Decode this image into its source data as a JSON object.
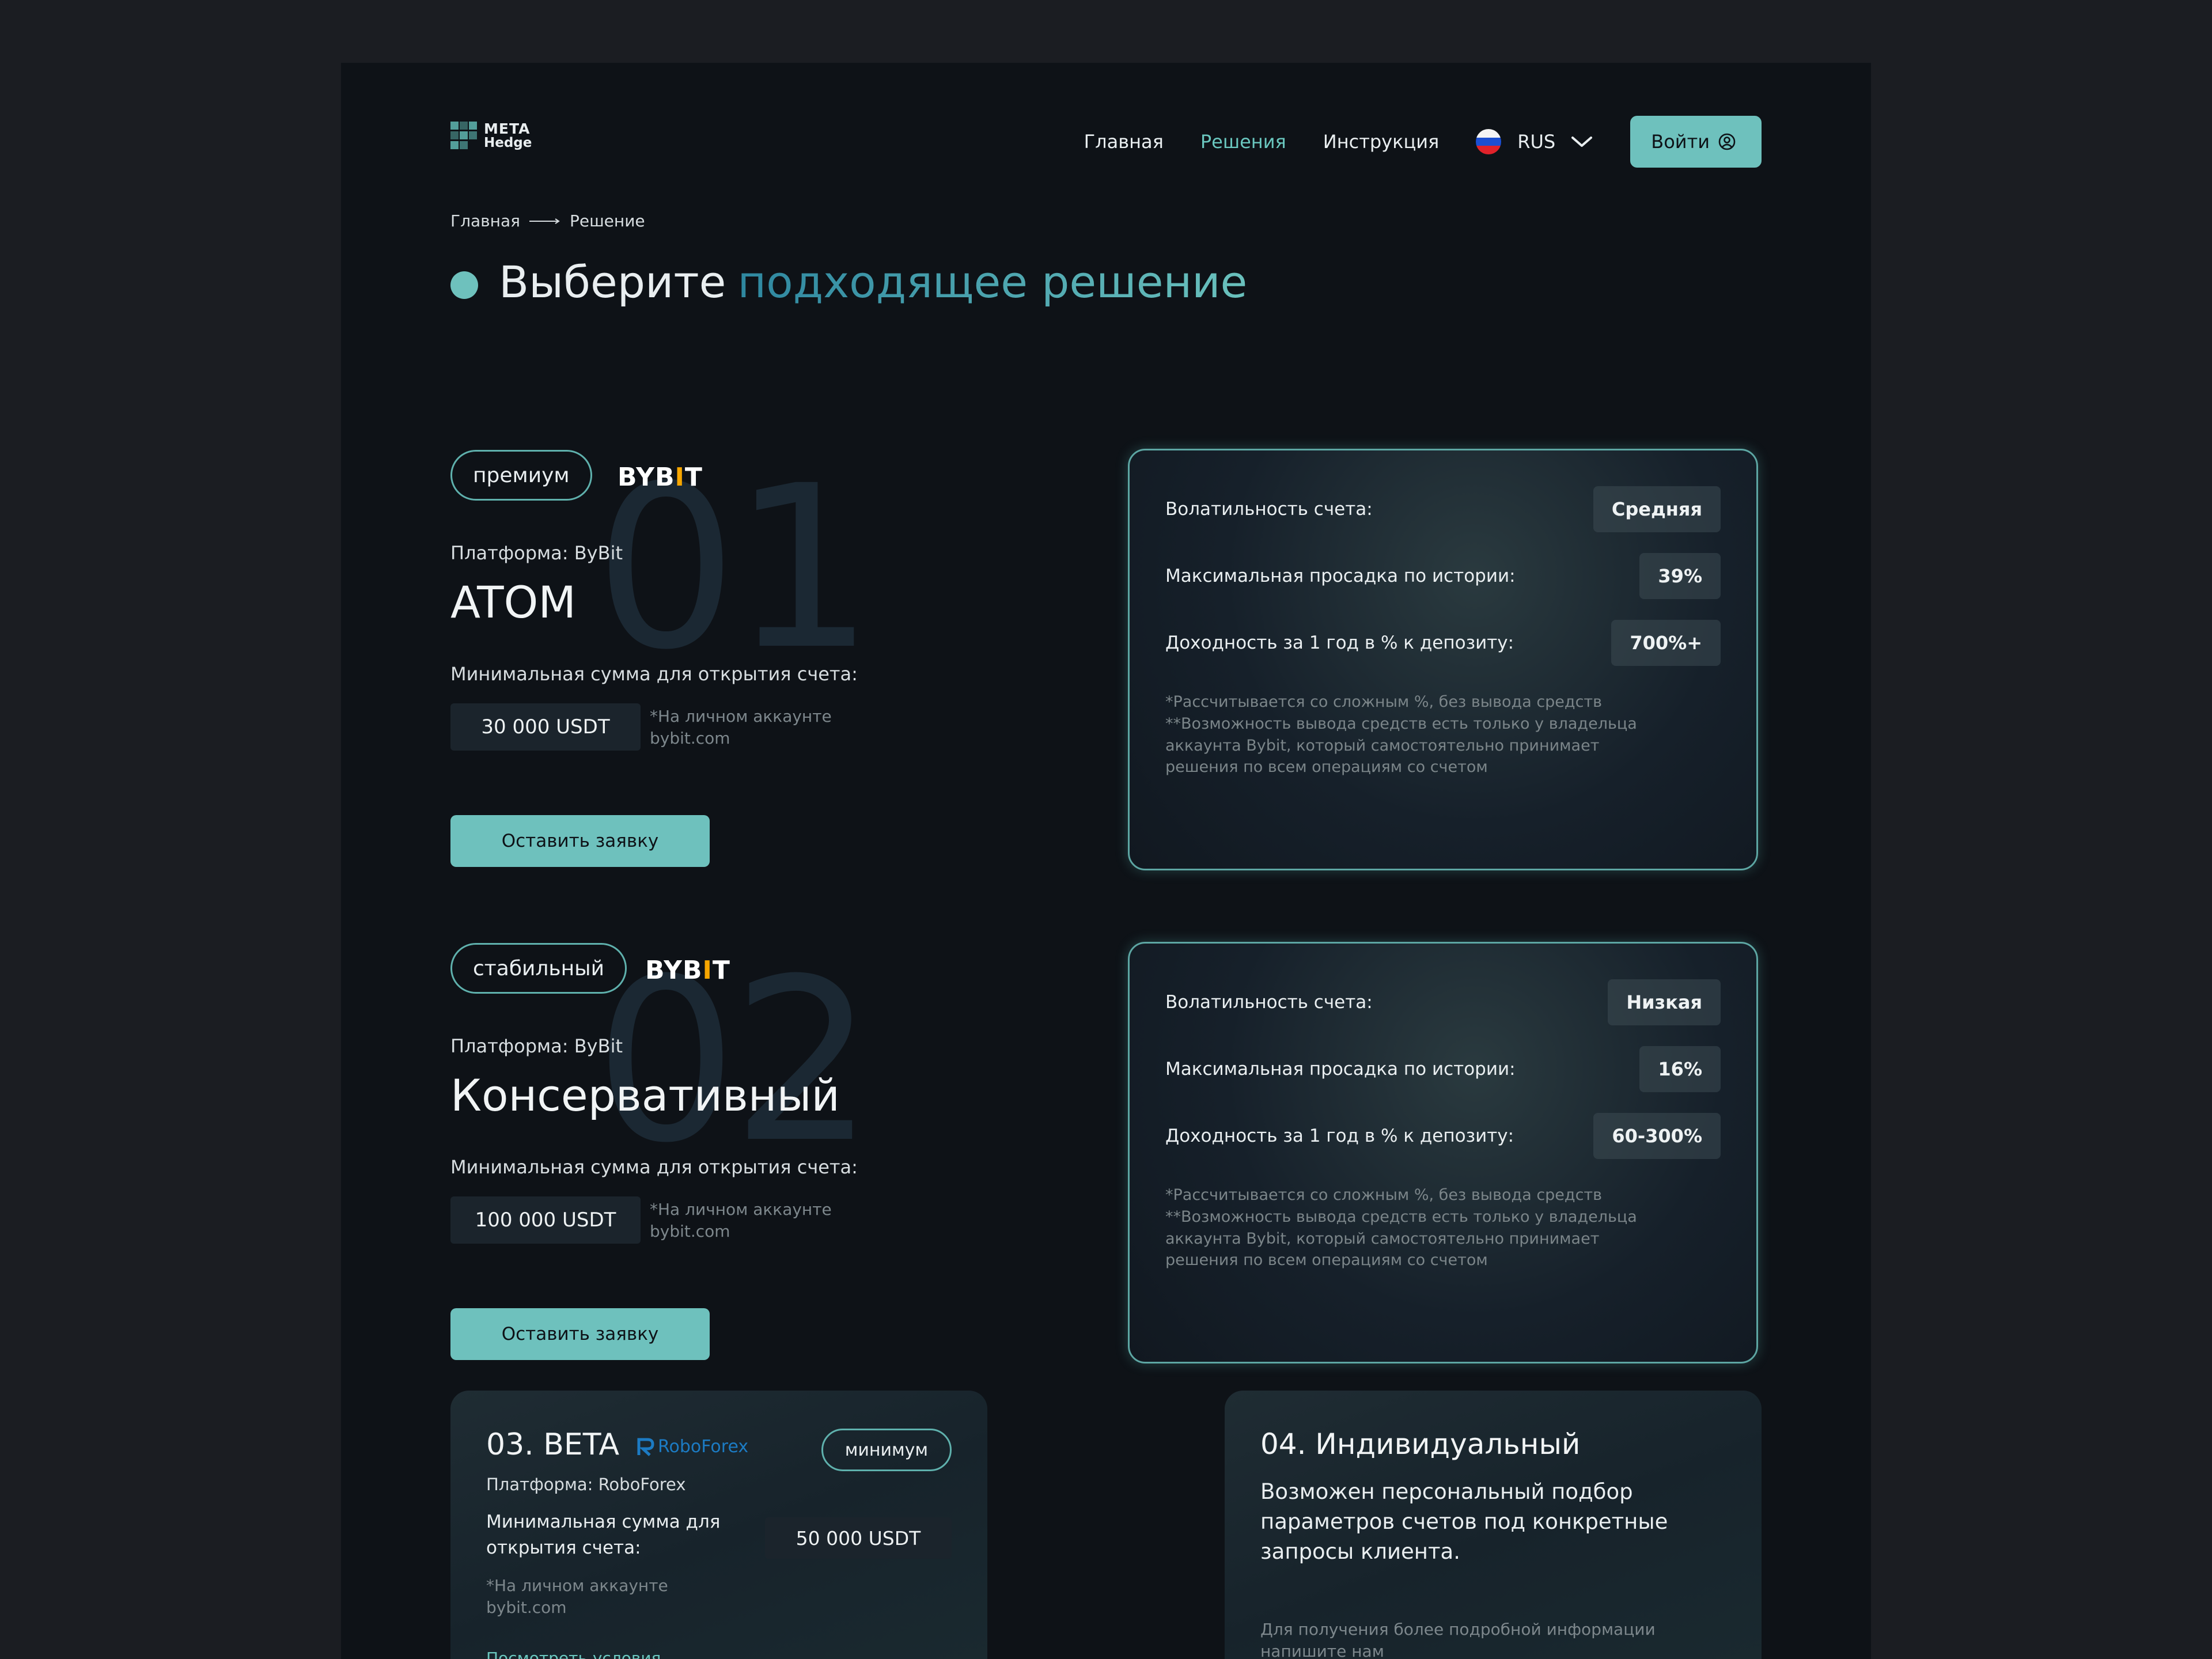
{
  "header": {
    "logo_line1": "META",
    "logo_line2": "Hedge",
    "nav": [
      "Главная",
      "Решения",
      "Инструкция"
    ],
    "active_nav": "Решения",
    "language": "RUS",
    "login_label": "Войти"
  },
  "breadcrumb": {
    "home": "Главная",
    "current": "Решение"
  },
  "title": {
    "lead": "Выберите",
    "accent": "подходящее решение"
  },
  "products": [
    {
      "number": "01",
      "tag": "премиум",
      "exchange": {
        "a": "BYB",
        "i": "I",
        "b": "T"
      },
      "platform": "Платформа: ByBit",
      "name": "ATOM",
      "min_label": "Минимальная сумма для открытия счета:",
      "amount": "30 000 USDT",
      "amount_note_1": "*На личном аккаунте",
      "amount_note_2": "bybit.com",
      "apply_label": "Оставить заявку",
      "stats": [
        {
          "label": "Волатильность счета:",
          "value": "Средняя"
        },
        {
          "label": "Максимальная просадка по истории:",
          "value": "39%"
        },
        {
          "label": "Доходность за 1 год в % к депозиту:",
          "value": "700%+"
        }
      ],
      "notes": [
        "*Рассчитывается со сложным %, без вывода средств",
        "**Возможность вывода средств есть только у владельца аккаунта Bybit, который самостоятельно принимает решения по всем операциям со счетом"
      ]
    },
    {
      "number": "02",
      "tag": "стабильный",
      "exchange": {
        "a": "BYB",
        "i": "I",
        "b": "T"
      },
      "platform": "Платформа: ByBit",
      "name": "Консервативный",
      "min_label": "Минимальная сумма для открытия счета:",
      "amount": "100 000 USDT",
      "amount_note_1": "*На личном аккаунте",
      "amount_note_2": "bybit.com",
      "apply_label": "Оставить заявку",
      "stats": [
        {
          "label": "Волатильность счета:",
          "value": "Низкая"
        },
        {
          "label": "Максимальная просадка по истории:",
          "value": "16%"
        },
        {
          "label": "Доходность за 1 год в % к депозиту:",
          "value": "60-300%"
        }
      ],
      "notes": [
        "*Рассчитывается со сложным %, без вывода средств",
        "**Возможность вывода средств есть только у владельца аккаунта Bybit, который самостоятельно принимает решения по всем операциям со счетом"
      ]
    }
  ],
  "card3": {
    "title": "03. BETA",
    "broker": "RoboForex",
    "tag": "минимум",
    "platform": "Платформа: RoboForex",
    "min_label": "Минимальная сумма для открытия счета:",
    "amount": "50 000 USDT",
    "note_1": "*На личном аккаунте",
    "note_2": "bybit.com",
    "link": "Посмотреть условия"
  },
  "card4": {
    "title": "04. Индивидуальный",
    "description": "Возможен персональный подбор параметров счетов под конкретные запросы клиента.",
    "note": "Для получения более подробной информации напишите нам"
  },
  "colors": {
    "accent": "#6ec1bd",
    "background": "#0e1217",
    "bybit_i": "#f7a600",
    "roboforex": "#1c7bc3"
  }
}
